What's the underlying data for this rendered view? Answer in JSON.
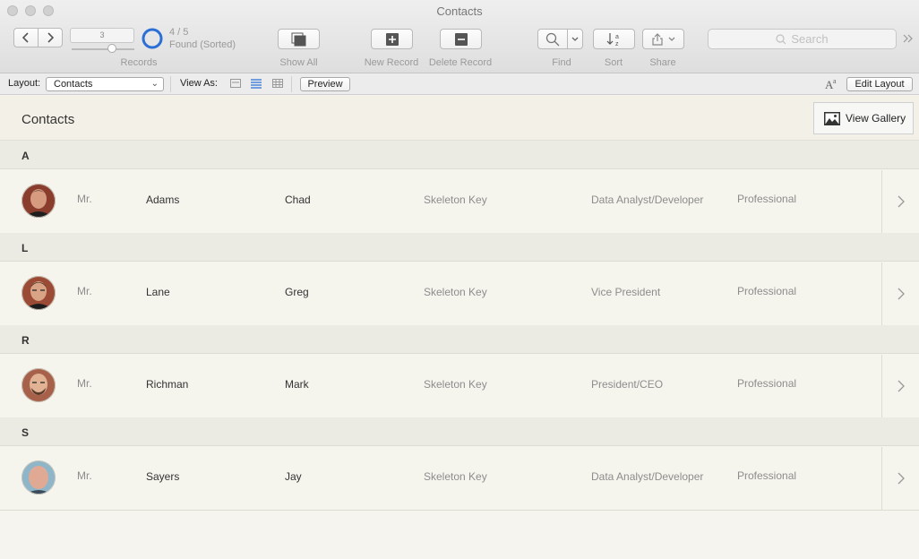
{
  "window": {
    "title": "Contacts"
  },
  "toolbar": {
    "record_value": "3",
    "found_count": "4 / 5",
    "found_status": "Found (Sorted)",
    "records_label": "Records",
    "show_all_label": "Show All",
    "new_record_label": "New Record",
    "delete_record_label": "Delete Record",
    "find_label": "Find",
    "sort_label": "Sort",
    "share_label": "Share",
    "search_placeholder": "Search"
  },
  "layoutbar": {
    "layout_label": "Layout:",
    "layout_value": "Contacts",
    "view_as_label": "View As:",
    "preview_label": "Preview",
    "edit_layout_label": "Edit Layout"
  },
  "content": {
    "title": "Contacts",
    "view_gallery_label": "View Gallery"
  },
  "groups": [
    {
      "letter": "A"
    },
    {
      "letter": "L"
    },
    {
      "letter": "R"
    },
    {
      "letter": "S"
    }
  ],
  "contacts": [
    {
      "title": "Mr.",
      "last": "Adams",
      "first": "Chad",
      "company": "Skeleton Key",
      "job": "Data Analyst/Developer",
      "category": "Professional"
    },
    {
      "title": "Mr.",
      "last": "Lane",
      "first": "Greg",
      "company": "Skeleton Key",
      "job": "Vice President",
      "category": "Professional"
    },
    {
      "title": "Mr.",
      "last": "Richman",
      "first": "Mark",
      "company": "Skeleton Key",
      "job": "President/CEO",
      "category": "Professional"
    },
    {
      "title": "Mr.",
      "last": "Sayers",
      "first": "Jay",
      "company": "Skeleton Key",
      "job": "Data Analyst/Developer",
      "category": "Professional"
    }
  ],
  "colors": {
    "progress_ring": "#2b6fd6",
    "background": "#f5f4ef",
    "group_band": "#ecebe3"
  }
}
